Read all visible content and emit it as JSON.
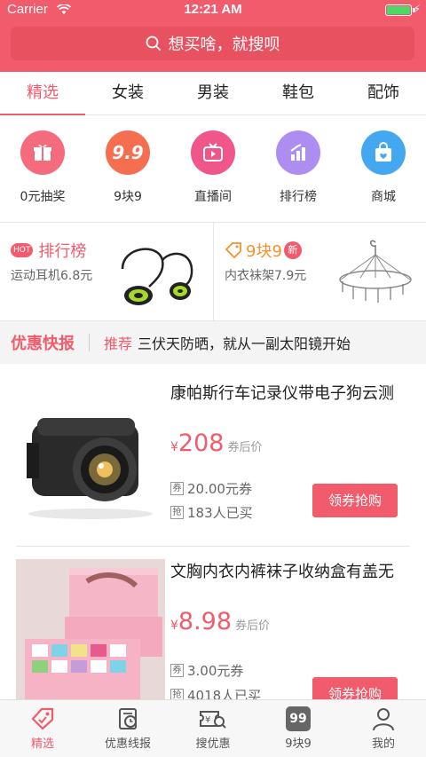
{
  "status": {
    "carrier": "Carrier",
    "time": "12:21 AM"
  },
  "search": {
    "placeholder": "想买啥，就搜呗"
  },
  "tabs": [
    {
      "label": "精选",
      "active": true
    },
    {
      "label": "女装"
    },
    {
      "label": "男装"
    },
    {
      "label": "鞋包"
    },
    {
      "label": "配饰"
    }
  ],
  "quick": [
    {
      "label": "0元抽奖",
      "icon": "gift-icon",
      "color": "#f46b7d"
    },
    {
      "label": "9块9",
      "icon": "nine-nine-icon",
      "color": "#f56e50",
      "glyph": "9.9"
    },
    {
      "label": "直播间",
      "icon": "tv-icon",
      "color": "#f0568a"
    },
    {
      "label": "排行榜",
      "icon": "ranking-icon",
      "color": "#ad8ef0"
    },
    {
      "label": "商城",
      "icon": "shopping-bag-icon",
      "color": "#44a8f0"
    }
  ],
  "promo": {
    "left": {
      "badge": "HOT",
      "title": "排行榜",
      "subtitle": "运动耳机6.8元",
      "title_color": "#f15b6b"
    },
    "right": {
      "title": "9块9",
      "new_badge": "新",
      "subtitle": "内衣袜架7.9元",
      "title_color": "#f5922b"
    }
  },
  "news": {
    "title": "优惠快报",
    "tag": "推荐",
    "text": "三伏天防晒，就从一副太阳镜开始"
  },
  "products": [
    {
      "name": "康帕斯行车记录仪带电子狗云测",
      "yen": "¥",
      "price": "208",
      "after": "券后价",
      "coupon_icon": "券",
      "coupon": "20.00元券",
      "sold_icon": "抢",
      "sold": "183人已买",
      "button": "领券抢购"
    },
    {
      "name": "文胸内衣内裤袜子收纳盒有盖无",
      "yen": "¥",
      "price": "8.98",
      "after": "券后价",
      "coupon_icon": "券",
      "coupon": "3.00元券",
      "sold_icon": "抢",
      "sold": "4018人已买",
      "button": "领券抢购"
    }
  ],
  "bottom_nav": [
    {
      "label": "精选",
      "icon": "tag-icon",
      "active": true
    },
    {
      "label": "优惠线报",
      "icon": "clock-doc-icon"
    },
    {
      "label": "搜优惠",
      "icon": "search-coupon-icon"
    },
    {
      "label": "9块9",
      "icon": "nine-nine-icon",
      "glyph": "99"
    },
    {
      "label": "我的",
      "icon": "person-icon"
    }
  ],
  "colors": {
    "accent": "#f15b6b",
    "search_bg": "#e8515f"
  }
}
